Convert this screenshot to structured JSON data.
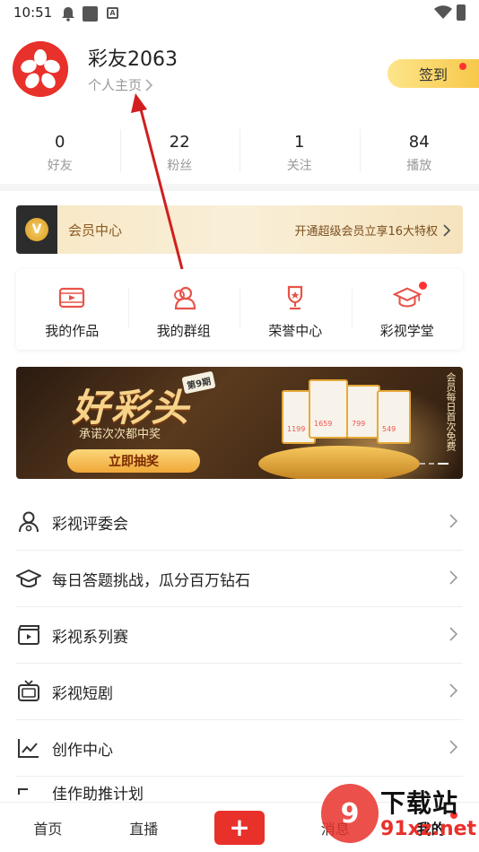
{
  "status_bar": {
    "time": "10:51"
  },
  "profile": {
    "username": "彩友2063",
    "profile_link": "个人主页",
    "checkin_label": "签到"
  },
  "stats": [
    {
      "value": "0",
      "label": "好友"
    },
    {
      "value": "22",
      "label": "粉丝"
    },
    {
      "value": "1",
      "label": "关注"
    },
    {
      "value": "84",
      "label": "播放"
    }
  ],
  "vip": {
    "badge": "V",
    "title": "会员中心",
    "promo": "开通超级会员立享16大特权"
  },
  "quick_actions": [
    {
      "label": "我的作品",
      "icon": "video-icon"
    },
    {
      "label": "我的群组",
      "icon": "group-icon"
    },
    {
      "label": "荣誉中心",
      "icon": "trophy-icon"
    },
    {
      "label": "彩视学堂",
      "icon": "graduation-cap-icon",
      "has_badge": true
    }
  ],
  "banner": {
    "title": "好彩头",
    "issue_badge": "第9期",
    "subtitle": "承诺次次都中奖",
    "button": "立即抽奖",
    "side_text": "会员每日首次免费",
    "prizes": [
      "1199",
      "1659",
      "799",
      "549"
    ]
  },
  "menu": [
    {
      "label": "彩视评委会",
      "icon": "judge-icon"
    },
    {
      "label": "每日答题挑战，瓜分百万钻石",
      "icon": "graduation-cap-icon"
    },
    {
      "label": "彩视系列赛",
      "icon": "clapperboard-icon"
    },
    {
      "label": "彩视短剧",
      "icon": "tv-icon"
    },
    {
      "label": "创作中心",
      "icon": "chart-line-icon"
    },
    {
      "label": "佳作助推计划",
      "icon": "rocket-icon"
    }
  ],
  "tabbar": {
    "home": "首页",
    "live": "直播",
    "plus": "+",
    "messages": "消息",
    "mine": "我的"
  },
  "watermark": {
    "logo": "9",
    "title": "下载站",
    "url": "91xz.net"
  },
  "colors": {
    "brand_red": "#e8312a",
    "annotation_arrow": "#d11f1f",
    "checkin_yellow": "#f7c84a",
    "vip_gold": "#8a5a23"
  }
}
